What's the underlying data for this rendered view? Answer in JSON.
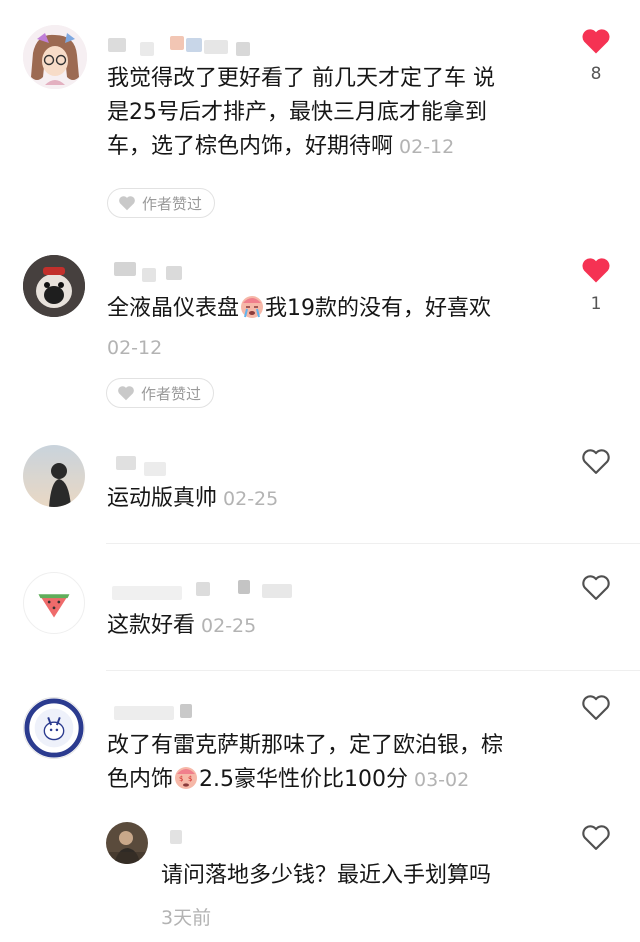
{
  "comments": [
    {
      "text": "我觉得改了更好看了 前几天才定了车 说是25号后才排产，最快三月底才能拿到车，选了棕色内饰，好期待啊",
      "line1": "我觉得改了更好看了 前几天才定了车 说",
      "line2": "是25号后才排产，最快三月底才能拿到",
      "line3": "车，选了棕色内饰，好期待啊",
      "date": "02-12",
      "author_liked_label": "作者赞过",
      "likes": "8",
      "liked": true
    },
    {
      "text_before_emoji": "全液晶仪表盘",
      "text_after_emoji": "我19款的没有，好喜欢",
      "date": "02-12",
      "author_liked_label": "作者赞过",
      "likes": "1",
      "liked": true
    },
    {
      "text": "运动版真帅",
      "date": "02-25",
      "liked": false
    },
    {
      "text": "这款好看",
      "date": "02-25",
      "liked": false
    },
    {
      "line1": "改了有雷克萨斯那味了，定了欧泊银，棕",
      "line2_before_emoji": "色内饰",
      "line2_after_emoji": "2.5豪华性价比100分",
      "date": "03-02",
      "liked": false,
      "reply": {
        "text": "请问落地多少钱？最近入手划算吗",
        "date": "3天前",
        "liked": false
      }
    }
  ],
  "colors": {
    "heart_active": "#f53253",
    "heart_outline": "#505050",
    "date": "#b3b3b3"
  },
  "icons": [
    "heart-filled-icon",
    "heart-outline-icon",
    "crying-emoji-icon",
    "money-face-emoji-icon",
    "watermelon-icon"
  ]
}
